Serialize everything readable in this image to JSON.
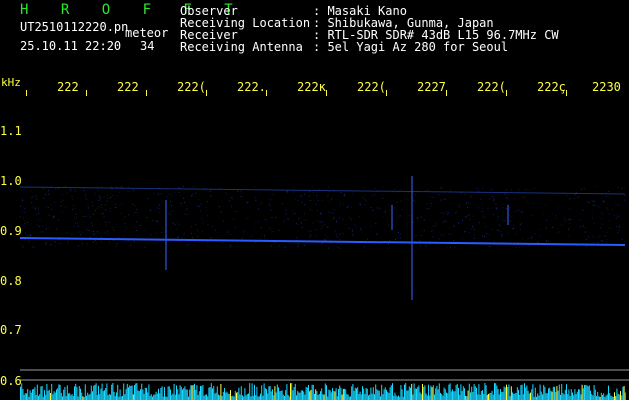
{
  "header": {
    "program": "H R O F F T",
    "filename": "UT2510112220.pn",
    "mode": "meteor",
    "datetime": "25.10.11 22:20",
    "count": "34",
    "labels": {
      "observer": "Observer",
      "location": "Receiving Location",
      "receiver": "Receiver",
      "antenna": "Receiving Antenna"
    },
    "values": {
      "observer": ": Masaki Kano",
      "location": ": Shibukawa, Gunma, Japan",
      "receiver": ": RTL-SDR SDR# 43dB L15 96.7MHz CW",
      "antenna": ": 5el Yagi Az 280 for Seoul"
    }
  },
  "axis": {
    "unit": "kHz",
    "time_ticks": [
      "222",
      "222",
      "222(",
      "222.",
      "222ĸ",
      "222(",
      "2227",
      "222(",
      "222ç",
      "2230"
    ],
    "freq_ticks": [
      "1.1",
      "1.0",
      "0.9",
      "0.8",
      "0.7",
      "0.6"
    ]
  },
  "colors": {
    "header_green": "#2fe62f",
    "label_white": "#ffffff",
    "tick_yellow": "#ffff40",
    "signal_blue": "#2a5cff",
    "noise_cyan": "#19d7ff"
  }
}
